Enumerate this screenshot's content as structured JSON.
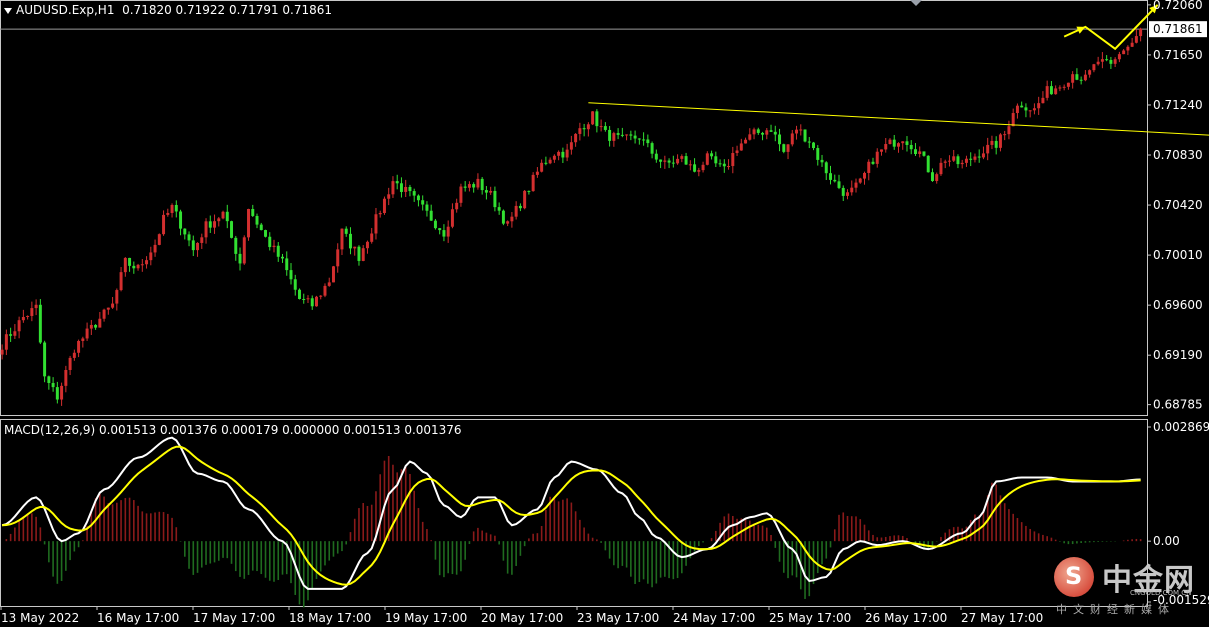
{
  "header": {
    "symbol": "AUDUSD.Exp,H1",
    "ohlc": "0.71820 0.71922 0.71791 0.71861"
  },
  "macd": {
    "label": "MACD(12,26,9) 0.001513 0.001376 0.000179 0.000000 0.001513 0.001376"
  },
  "colors": {
    "background": "#000000",
    "bull_candle": "#d32f2f",
    "bear_candle": "#32e032",
    "trendline": "#ffff00",
    "arrow": "#ffff00",
    "macd_line": "#ffffff",
    "signal_line": "#ffff00",
    "hist_pos": "#8b1a1a",
    "hist_neg": "#1f6b1f",
    "axis": "#ffffff",
    "current_price_line": "#9a9a9a"
  },
  "chart_data": {
    "type": "candlestick",
    "ylim": [
      0.687,
      0.721
    ],
    "y_ticks": [
      "0.72060",
      "0.71650",
      "0.71240",
      "0.70830",
      "0.70420",
      "0.70010",
      "0.69600",
      "0.69190",
      "0.68785"
    ],
    "current_price": "0.71861",
    "x_ticks": [
      "13 May 2022",
      "16 May 17:00",
      "17 May 17:00",
      "18 May 17:00",
      "19 May 17:00",
      "20 May 17:00",
      "23 May 17:00",
      "24 May 17:00",
      "25 May 17:00",
      "26 May 17:00",
      "27 May 17:00"
    ],
    "price_path": [
      [
        0,
        0.6928
      ],
      [
        5,
        0.695
      ],
      [
        8,
        0.6958
      ],
      [
        10,
        0.69
      ],
      [
        13,
        0.6885
      ],
      [
        17,
        0.6925
      ],
      [
        22,
        0.6945
      ],
      [
        26,
        0.696
      ],
      [
        29,
        0.6995
      ],
      [
        32,
        0.699
      ],
      [
        36,
        0.701
      ],
      [
        38,
        0.703
      ],
      [
        40,
        0.704
      ],
      [
        43,
        0.702
      ],
      [
        45,
        0.7005
      ],
      [
        48,
        0.7025
      ],
      [
        52,
        0.7035
      ],
      [
        54,
        0.7015
      ],
      [
        56,
        0.6995
      ],
      [
        58,
        0.704
      ],
      [
        62,
        0.7015
      ],
      [
        66,
        0.6995
      ],
      [
        70,
        0.6965
      ],
      [
        73,
        0.696
      ],
      [
        77,
        0.698
      ],
      [
        80,
        0.702
      ],
      [
        84,
        0.7
      ],
      [
        88,
        0.703
      ],
      [
        92,
        0.7062
      ],
      [
        96,
        0.705
      ],
      [
        100,
        0.7035
      ],
      [
        104,
        0.702
      ],
      [
        108,
        0.7055
      ],
      [
        112,
        0.706
      ],
      [
        115,
        0.705
      ],
      [
        119,
        0.7025
      ],
      [
        123,
        0.705
      ],
      [
        127,
        0.7075
      ],
      [
        130,
        0.7085
      ],
      [
        133,
        0.7085
      ],
      [
        136,
        0.7105
      ],
      [
        139,
        0.7115
      ],
      [
        142,
        0.71
      ],
      [
        146,
        0.7095
      ],
      [
        150,
        0.7098
      ],
      [
        153,
        0.7085
      ],
      [
        156,
        0.7075
      ],
      [
        160,
        0.708
      ],
      [
        163,
        0.707
      ],
      [
        166,
        0.708
      ],
      [
        170,
        0.707
      ],
      [
        173,
        0.709
      ],
      [
        177,
        0.71
      ],
      [
        181,
        0.7105
      ],
      [
        184,
        0.7085
      ],
      [
        187,
        0.7105
      ],
      [
        190,
        0.7095
      ],
      [
        193,
        0.7075
      ],
      [
        196,
        0.706
      ],
      [
        199,
        0.705
      ],
      [
        202,
        0.706
      ],
      [
        205,
        0.708
      ],
      [
        208,
        0.709
      ],
      [
        212,
        0.7098
      ],
      [
        216,
        0.7085
      ],
      [
        219,
        0.7065
      ],
      [
        222,
        0.708
      ],
      [
        226,
        0.7075
      ],
      [
        230,
        0.7085
      ],
      [
        234,
        0.7092
      ],
      [
        236,
        0.71
      ],
      [
        238,
        0.712
      ],
      [
        240,
        0.7125
      ],
      [
        243,
        0.712
      ],
      [
        246,
        0.7135
      ],
      [
        249,
        0.714
      ],
      [
        252,
        0.715
      ],
      [
        255,
        0.7145
      ],
      [
        258,
        0.716
      ],
      [
        261,
        0.7155
      ],
      [
        264,
        0.717
      ],
      [
        266,
        0.7175
      ],
      [
        268,
        0.7186
      ]
    ],
    "trendline": [
      [
        138,
        0.71258
      ],
      [
        286,
        0.7099
      ]
    ],
    "arrow": [
      [
        250,
        0.718
      ],
      [
        255,
        0.7188
      ],
      [
        262,
        0.717
      ],
      [
        272,
        0.7206
      ]
    ],
    "macd_ylim": [
      -0.001529,
      0.002869
    ],
    "macd_y_ticks": [
      "0.002869",
      "0.00",
      "-0.001529"
    ],
    "macd_key_points": [
      [
        0,
        0.0004
      ],
      [
        8,
        0.0011
      ],
      [
        14,
        0.0
      ],
      [
        18,
        0.0002
      ],
      [
        24,
        0.0013
      ],
      [
        32,
        0.0021
      ],
      [
        40,
        0.0026
      ],
      [
        46,
        0.0017
      ],
      [
        52,
        0.0015
      ],
      [
        58,
        0.0008
      ],
      [
        66,
        0.0
      ],
      [
        72,
        -0.0012
      ],
      [
        80,
        -0.0012
      ],
      [
        86,
        -0.0003
      ],
      [
        92,
        0.0013
      ],
      [
        96,
        0.002
      ],
      [
        100,
        0.0017
      ],
      [
        104,
        0.0009
      ],
      [
        108,
        0.0006
      ],
      [
        112,
        0.0011
      ],
      [
        116,
        0.0011
      ],
      [
        120,
        0.0004
      ],
      [
        126,
        0.0008
      ],
      [
        130,
        0.0016
      ],
      [
        134,
        0.002
      ],
      [
        140,
        0.0018
      ],
      [
        146,
        0.0012
      ],
      [
        150,
        0.0006
      ],
      [
        154,
        0.0001
      ],
      [
        160,
        -0.0004
      ],
      [
        166,
        -0.0002
      ],
      [
        172,
        0.0004
      ],
      [
        176,
        0.0006
      ],
      [
        180,
        0.0007
      ],
      [
        186,
        -0.0002
      ],
      [
        190,
        -0.001
      ],
      [
        194,
        -0.0009
      ],
      [
        198,
        -0.0002
      ],
      [
        202,
        0.0
      ],
      [
        206,
        -0.0001
      ],
      [
        212,
        0.0
      ],
      [
        218,
        -0.0002
      ],
      [
        226,
        0.0002
      ],
      [
        230,
        0.0006
      ],
      [
        234,
        0.0015
      ],
      [
        240,
        0.0016
      ],
      [
        246,
        0.0016
      ],
      [
        252,
        0.0015
      ],
      [
        256,
        0.0015
      ],
      [
        262,
        0.0015
      ],
      [
        268,
        0.00155
      ]
    ],
    "macd_signal_period": 9
  }
}
